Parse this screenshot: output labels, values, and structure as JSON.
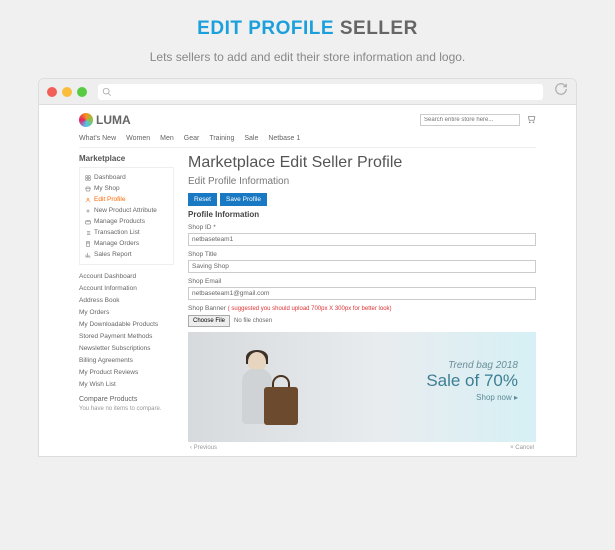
{
  "hero": {
    "title_blue": "EDIT PROFILE",
    "title_rest": "SELLER",
    "subtitle": "Lets sellers to add and edit their store information and logo."
  },
  "topsearch": {
    "placeholder": "Search entire store here..."
  },
  "logo": {
    "text": "LUMA"
  },
  "nav": [
    "What's New",
    "Women",
    "Men",
    "Gear",
    "Training",
    "Sale",
    "Netbase 1"
  ],
  "sidebar": {
    "title": "Marketplace",
    "items": [
      {
        "label": "Dashboard",
        "icon": "dash"
      },
      {
        "label": "My Shop",
        "icon": "shop"
      },
      {
        "label": "Edit Profile",
        "icon": "user",
        "active": true
      },
      {
        "label": "New Product Attribute",
        "icon": "plus"
      },
      {
        "label": "Manage Products",
        "icon": "box"
      },
      {
        "label": "Transaction List",
        "icon": "list"
      },
      {
        "label": "Manage Orders",
        "icon": "order"
      },
      {
        "label": "Sales Report",
        "icon": "chart"
      }
    ],
    "account": [
      "Account Dashboard",
      "Account Information",
      "Address Book",
      "My Orders",
      "My Downloadable Products",
      "Stored Payment Methods",
      "Newsletter Subscriptions",
      "Billing Agreements",
      "My Product Reviews",
      "My Wish List"
    ],
    "compare": {
      "title": "Compare Products",
      "empty": "You have no items to compare."
    }
  },
  "main": {
    "h1": "Marketplace Edit Seller Profile",
    "h2": "Edit Profile Information",
    "reset": "Reset",
    "save": "Save Profile",
    "section": "Profile Information",
    "fields": {
      "shop_id": {
        "label": "Shop ID *",
        "value": "netbaseteam1"
      },
      "shop_title": {
        "label": "Shop Title",
        "value": "Saving Shop"
      },
      "shop_email": {
        "label": "Shop Email",
        "value": "netbaseteam1@gmail.com"
      }
    },
    "banner_label": "Shop Banner",
    "banner_hint": "( suggested you should upload 700px X 300px for better look)",
    "choose": "Choose File",
    "nofile": "No file chosen",
    "promo": {
      "line1": "Trend bag 2018",
      "line2": "Sale of 70%",
      "line3": "Shop now ▸"
    },
    "prev": "‹ Previous",
    "cancel": "× Cancel"
  }
}
